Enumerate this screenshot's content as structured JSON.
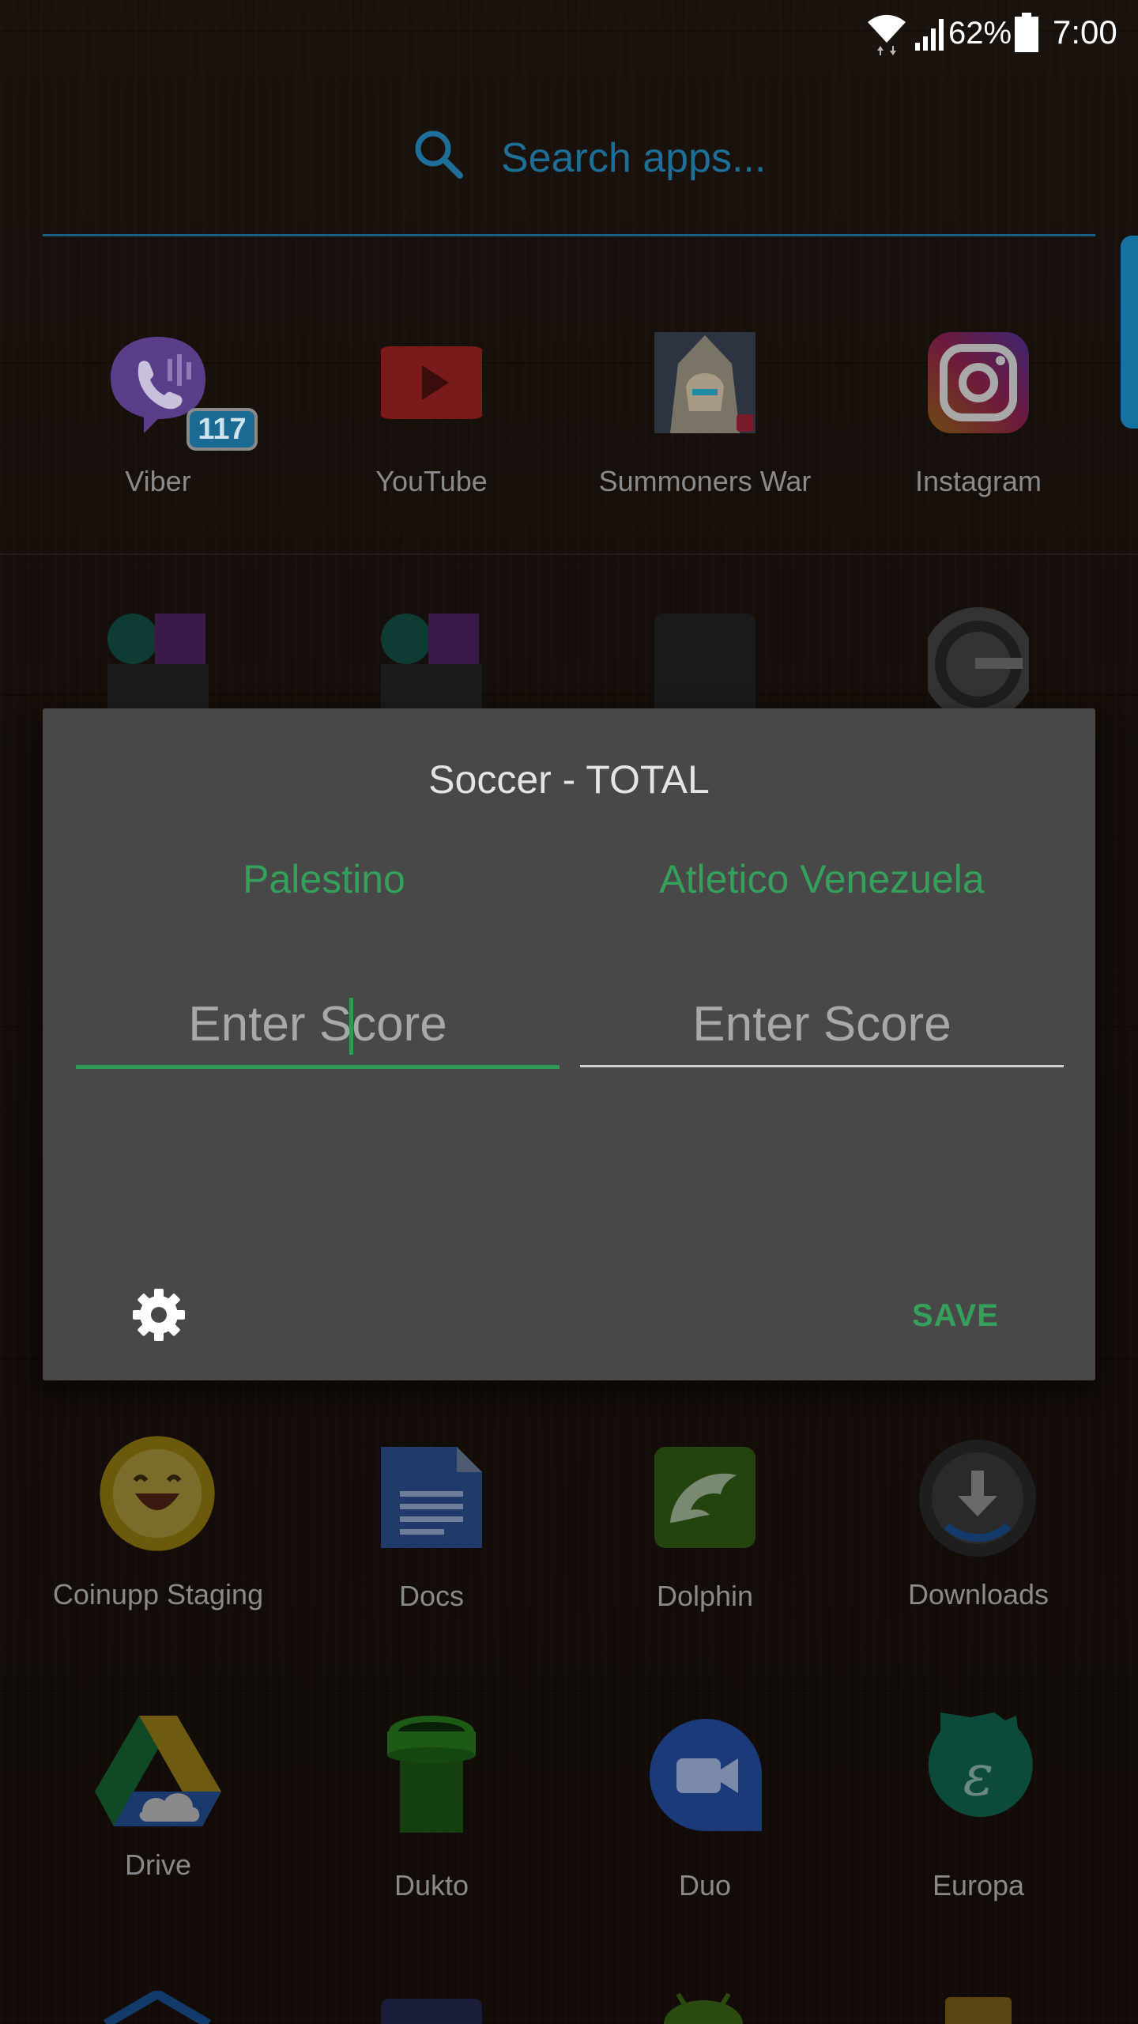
{
  "status_bar": {
    "battery_percent": "62%",
    "time": "7:00"
  },
  "search": {
    "placeholder": "Search apps..."
  },
  "apps_row1": [
    {
      "label": "Viber",
      "icon": "viber-icon",
      "badge": "117"
    },
    {
      "label": "YouTube",
      "icon": "youtube-icon"
    },
    {
      "label": "Summoners War",
      "icon": "summoners-war-icon"
    },
    {
      "label": "Instagram",
      "icon": "instagram-icon"
    }
  ],
  "apps_row3": [
    {
      "label": "Coinupp Staging",
      "icon": "coinupp-icon"
    },
    {
      "label": "Docs",
      "icon": "docs-icon"
    },
    {
      "label": "Dolphin",
      "icon": "dolphin-icon"
    },
    {
      "label": "Downloads",
      "icon": "downloads-icon"
    }
  ],
  "apps_row4": [
    {
      "label": "Drive",
      "icon": "drive-icon"
    },
    {
      "label": "Dukto",
      "icon": "dukto-icon"
    },
    {
      "label": "Duo",
      "icon": "duo-icon"
    },
    {
      "label": "Europa",
      "icon": "europa-icon"
    }
  ],
  "dialog": {
    "title": "Soccer - TOTAL",
    "team_home": "Palestino",
    "team_away": "Atletico Venezuela",
    "score_home_placeholder": "Enter Score",
    "score_away_placeholder": "Enter Score",
    "save_label": "SAVE"
  },
  "colors": {
    "accent_green": "#35a05c",
    "search_blue": "#1e6f97",
    "dialog_bg": "#484848"
  }
}
